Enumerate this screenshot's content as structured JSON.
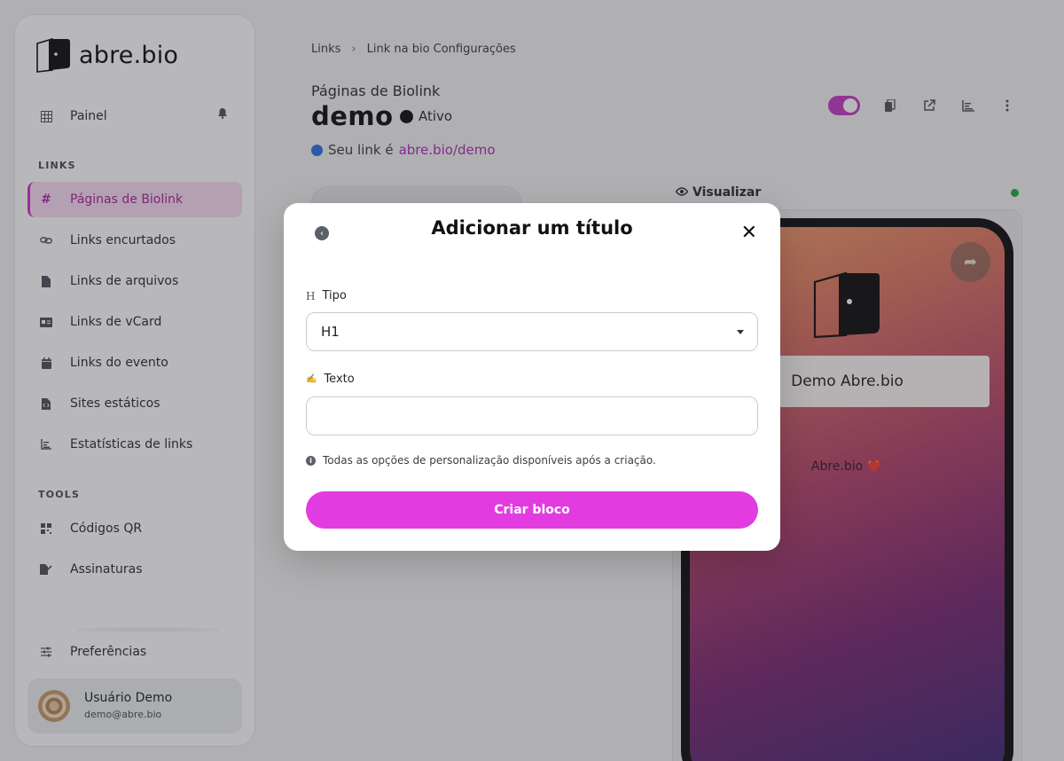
{
  "brand": {
    "name": "abre.bio",
    "accent": "#e23be0"
  },
  "sidebar": {
    "top_item": {
      "label": "Painel",
      "icon": "grid-icon"
    },
    "sections": [
      {
        "label": "LINKS"
      },
      {
        "label": "TOOLS"
      }
    ],
    "items": [
      {
        "label": "Páginas de Biolink",
        "icon": "hash-icon",
        "active": true
      },
      {
        "label": "Links encurtados",
        "icon": "link-icon"
      },
      {
        "label": "Links de arquivos",
        "icon": "file-icon"
      },
      {
        "label": "Links de vCard",
        "icon": "id-card-icon"
      },
      {
        "label": "Links do evento",
        "icon": "calendar-icon"
      },
      {
        "label": "Sites estáticos",
        "icon": "code-file-icon"
      },
      {
        "label": "Estatísticas de links",
        "icon": "chart-icon"
      }
    ],
    "tools": [
      {
        "label": "Códigos QR",
        "icon": "qr-icon"
      },
      {
        "label": "Assinaturas",
        "icon": "signature-icon"
      }
    ],
    "preferences": {
      "label": "Preferências",
      "icon": "sliders-icon"
    },
    "user": {
      "name": "Usuário Demo",
      "email": "demo@abre.bio"
    }
  },
  "breadcrumb": {
    "first": "Links",
    "second": "Link na bio Configurações"
  },
  "page": {
    "subtitle": "Páginas de Biolink",
    "title": "demo",
    "status": "Ativo",
    "link_prefix": "Seu link é",
    "link_url": "abre.bio/demo"
  },
  "preview": {
    "label": "Visualizar",
    "card_text": "Demo Abre.bio",
    "tagline": "Abre.bio ❤️"
  },
  "modal": {
    "title": "Adicionar um título",
    "type_label": "Tipo",
    "type_value": "H1",
    "text_label": "Texto",
    "text_value": "",
    "hint": "Todas as opções de personalização disponíveis após a criação.",
    "submit_label": "Criar bloco"
  }
}
